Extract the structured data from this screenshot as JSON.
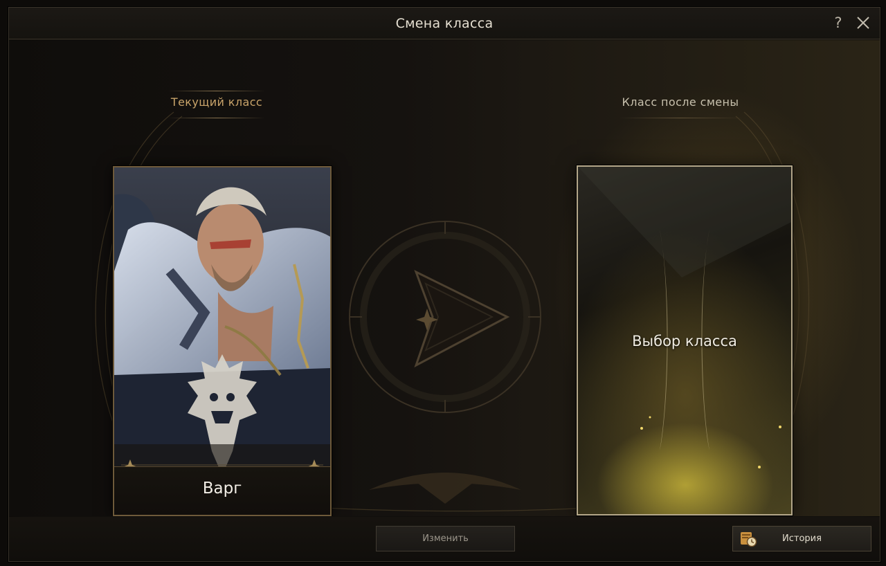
{
  "window": {
    "title": "Смена класса",
    "help_label": "?"
  },
  "current": {
    "label": "Текущий класс",
    "class_name": "Варг"
  },
  "target": {
    "label": "Класс после смены",
    "placeholder": "Выбор класса"
  },
  "actions": {
    "change_label": "Изменить",
    "history_label": "История"
  },
  "icons": {
    "help": "question-mark-icon",
    "close": "close-icon",
    "arrow": "right-arrow-icon",
    "history": "scroll-clock-icon",
    "class_emblem": "beast-crest-icon"
  },
  "colors": {
    "accent_gold": "#c9a46a",
    "frame": "#6e5a3a",
    "target_glow": "#d2be3c"
  }
}
